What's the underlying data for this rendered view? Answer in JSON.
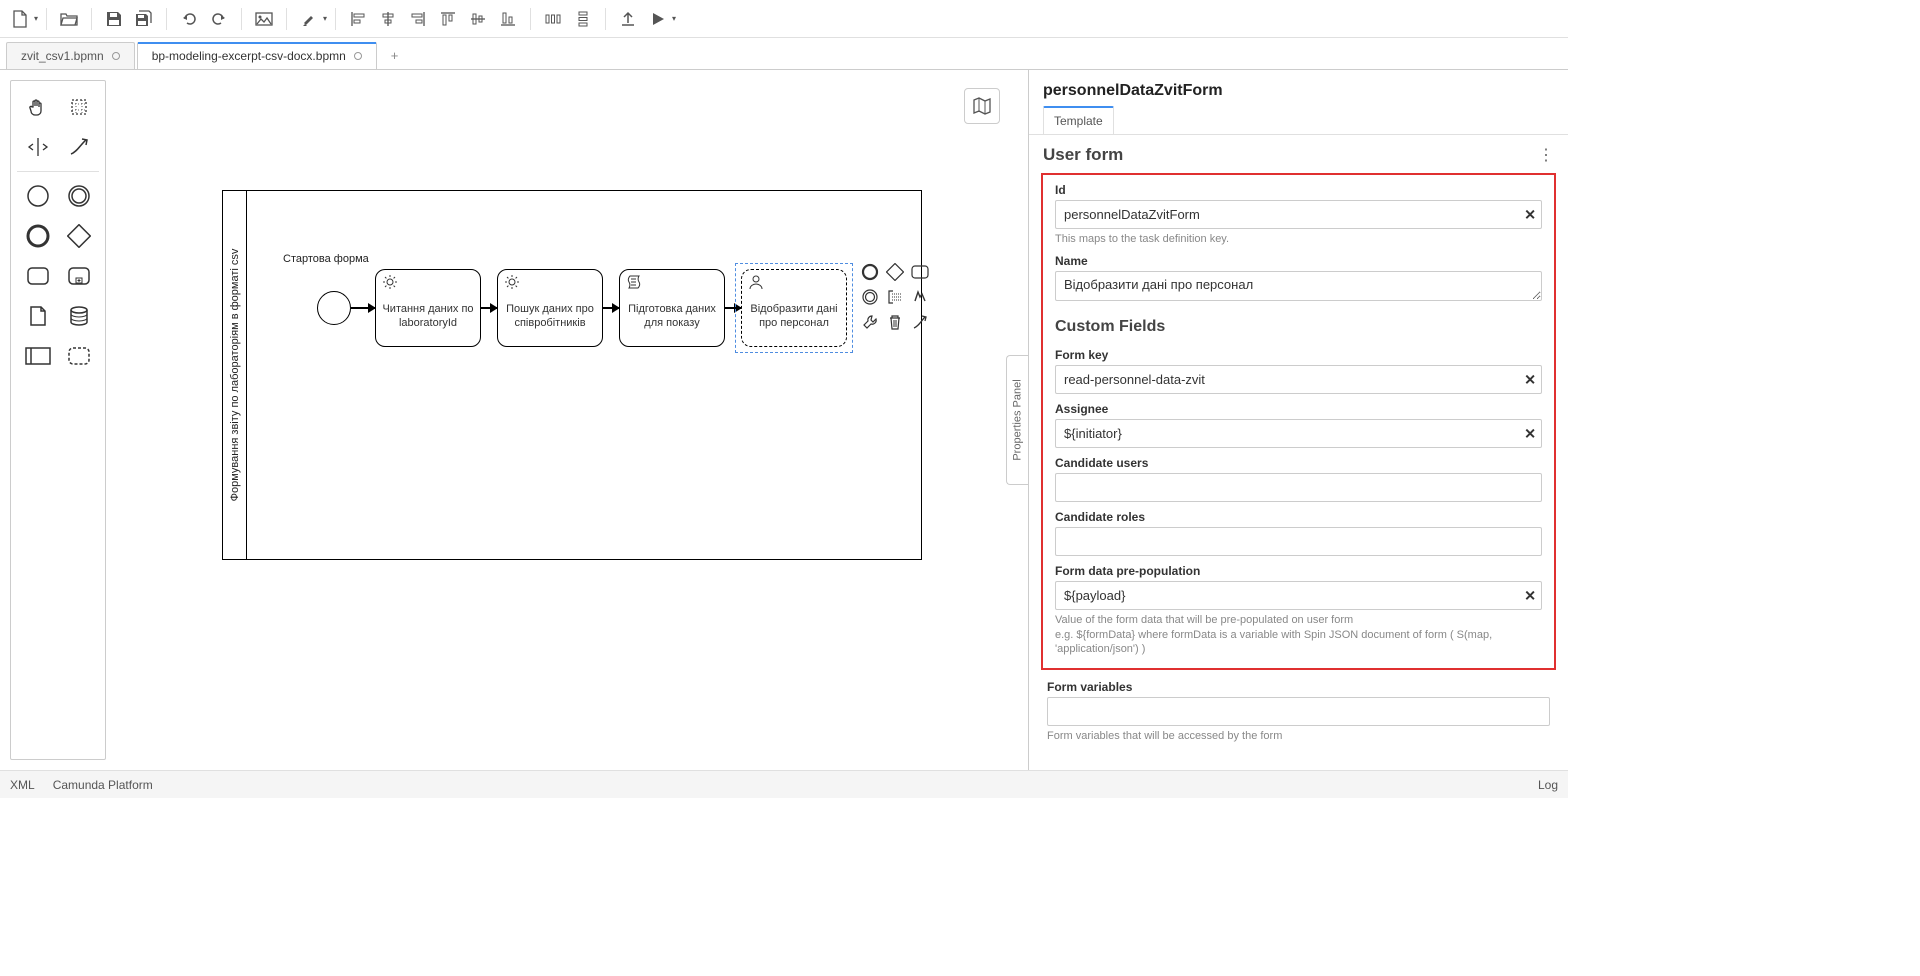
{
  "toolbar": {
    "new": "New file",
    "open": "Open",
    "save": "Save",
    "save_all": "Save all",
    "undo": "Undo",
    "redo": "Redo",
    "image": "Image",
    "highlight": "Highlight",
    "align_left": "Align left",
    "align_center_h": "Align center horizontal",
    "align_right": "Align right",
    "align_top": "Align top",
    "align_center_v": "Align center vertical",
    "align_bottom": "Align bottom",
    "dist_h": "Distribute horizontal",
    "dist_v": "Distribute vertical",
    "upload": "Upload",
    "run": "Run"
  },
  "tabs": {
    "items": [
      {
        "label": "zvit_csv1.bpmn",
        "active": false
      },
      {
        "label": "bp-modeling-excerpt-csv-docx.bpmn",
        "active": true
      }
    ],
    "add": "+"
  },
  "palette": {
    "hand": "hand-tool",
    "lasso": "lasso-tool",
    "space": "space-tool",
    "connect": "connect-tool",
    "start_event": "start-event",
    "intermediate_event": "intermediate-event",
    "end_event": "end-event",
    "gateway": "gateway",
    "task": "task",
    "sub_process": "sub-process",
    "data_object": "data-object",
    "data_store": "data-store",
    "participant": "participant",
    "group": "group"
  },
  "diagram": {
    "lane_label": "Формування звіту по лабораторіям в форматі csv",
    "start_label": "Стартова форма",
    "tasks": [
      "Читання даних по laboratoryId",
      "Пошук даних про співробітників",
      "Підготовка даних для показу",
      "Відобразити дані про персонал"
    ]
  },
  "minimap": "Toggle minimap",
  "props_handle": "Properties Panel",
  "panel": {
    "title": "personnelDataZvitForm",
    "tab_template": "Template",
    "section_user_form": "User form",
    "section_custom_fields": "Custom Fields",
    "id_label": "Id",
    "id_value": "personnelDataZvitForm",
    "id_hint": "This maps to the task definition key.",
    "name_label": "Name",
    "name_value": "Відобразити дані про персонал",
    "form_key_label": "Form key",
    "form_key_value": "read-personnel-data-zvit",
    "assignee_label": "Assignee",
    "assignee_value": "${initiator}",
    "cand_users_label": "Candidate users",
    "cand_users_value": "",
    "cand_roles_label": "Candidate roles",
    "cand_roles_value": "",
    "prepop_label": "Form data pre-population",
    "prepop_value": "${payload}",
    "prepop_hint": "Value of the form data that will be pre-populated on user form\ne.g. ${formData} where formData is a variable with Spin JSON document of form ( S(map, 'application/json') )",
    "form_vars_label": "Form variables",
    "form_vars_value": "",
    "form_vars_hint": "Form variables that will be accessed by the form"
  },
  "status": {
    "xml": "XML",
    "platform": "Camunda Platform",
    "log": "Log"
  }
}
